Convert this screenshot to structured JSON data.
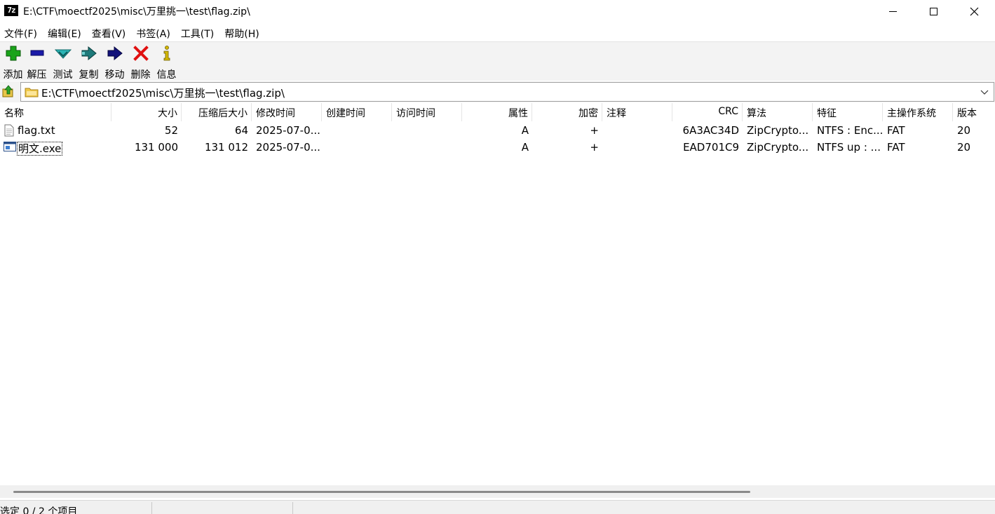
{
  "window": {
    "app_icon_text": "7z",
    "title": "E:\\CTF\\moectf2025\\misc\\万里挑一\\test\\flag.zip\\"
  },
  "menu": [
    "文件(F)",
    "编辑(E)",
    "查看(V)",
    "书签(A)",
    "工具(T)",
    "帮助(H)"
  ],
  "toolbar": {
    "buttons": [
      {
        "label": "添加",
        "icon": "add-icon"
      },
      {
        "label": "解压",
        "icon": "extract-icon"
      },
      {
        "label": "测试",
        "icon": "test-icon"
      },
      {
        "label": "复制",
        "icon": "copy-icon"
      },
      {
        "label": "移动",
        "icon": "move-icon"
      },
      {
        "label": "删除",
        "icon": "delete-icon"
      },
      {
        "label": "信息",
        "icon": "info-icon"
      }
    ]
  },
  "address": {
    "path": "E:\\CTF\\moectf2025\\misc\\万里挑一\\test\\flag.zip\\"
  },
  "columns": [
    "名称",
    "大小",
    "压缩后大小",
    "修改时间",
    "创建时间",
    "访问时间",
    "属性",
    "加密",
    "注释",
    "CRC",
    "算法",
    "特征",
    "主操作系统",
    "版本"
  ],
  "files": [
    {
      "name": "flag.txt",
      "icon": "text-file-icon",
      "size": "52",
      "packed": "64",
      "modified": "2025-07-0...",
      "created": "",
      "accessed": "",
      "attributes": "A",
      "encrypted": "+",
      "comment": "",
      "crc": "6A3AC34D",
      "method": "ZipCrypto...",
      "characteristics": "NTFS : Enc...",
      "host_os": "FAT",
      "version": "20"
    },
    {
      "name": "明文.exe",
      "icon": "exe-file-icon",
      "size": "131 000",
      "packed": "131 012",
      "modified": "2025-07-0...",
      "created": "",
      "accessed": "",
      "attributes": "A",
      "encrypted": "+",
      "comment": "",
      "crc": "EAD701C9",
      "method": "ZipCrypto...",
      "characteristics": "NTFS up : ...",
      "host_os": "FAT",
      "version": "20"
    }
  ],
  "status": {
    "selection": "选定 0 / 2 个项目"
  },
  "colors": {
    "add": "#19a319",
    "extract": "#1a1aa8",
    "test": "#2ab5b5",
    "copy": "#1e7a7a",
    "move": "#12127a",
    "delete": "#e01010",
    "info": "#d4b800"
  }
}
